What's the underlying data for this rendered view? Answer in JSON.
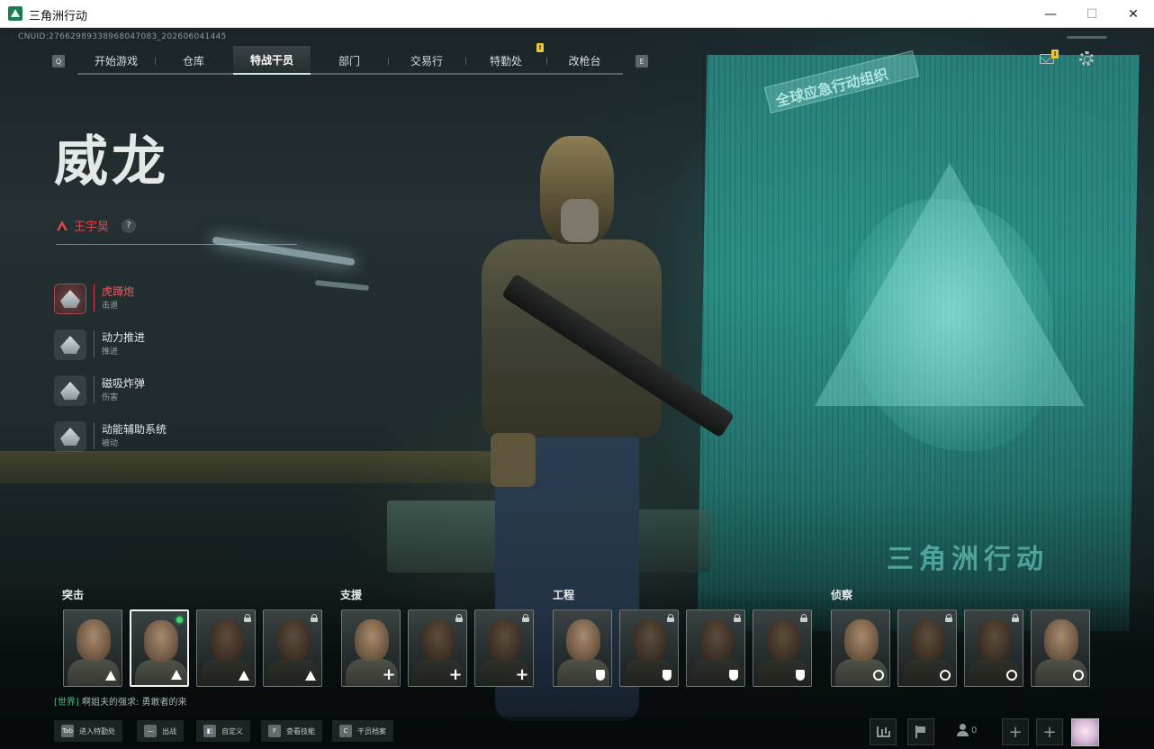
{
  "window": {
    "title": "三角洲行动",
    "minimize": "—",
    "maximize": "☐",
    "close": "✕"
  },
  "hud": {
    "uid": "CNUID:276629893389680470​83_202606041445",
    "nav_left_key": "Q",
    "nav_right_key": "E",
    "tabs": [
      {
        "label": "开始游戏"
      },
      {
        "label": "仓库"
      },
      {
        "label": "特战干员",
        "active": true
      },
      {
        "label": "部门"
      },
      {
        "label": "交易行"
      },
      {
        "label": "特勤处",
        "badge": "!"
      },
      {
        "label": "改枪台"
      }
    ],
    "mail_badge": "!"
  },
  "operator": {
    "name": "威龙",
    "real_name": "王宇昊",
    "help": "?",
    "abilities": [
      {
        "name": "虎蹲炮",
        "type": "击退",
        "selected": true,
        "icon": "cannon-icon"
      },
      {
        "name": "动力推进",
        "type": "推进",
        "icon": "dash-icon"
      },
      {
        "name": "磁吸炸弹",
        "type": "伤害",
        "icon": "bomb-icon"
      },
      {
        "name": "动能辅助系统",
        "type": "被动",
        "icon": "exosuit-icon"
      }
    ]
  },
  "roster": {
    "groups": [
      {
        "label": "突击",
        "class": "assault"
      },
      {
        "label": "支援",
        "class": "support"
      },
      {
        "label": "工程",
        "class": "engineer"
      },
      {
        "label": "侦察",
        "class": "recon"
      }
    ],
    "cards": [
      {
        "group": "assault",
        "locked": false
      },
      {
        "group": "assault",
        "locked": false,
        "selected": true,
        "online": true
      },
      {
        "group": "assault",
        "locked": true
      },
      {
        "group": "assault",
        "locked": true
      },
      {
        "group": "support",
        "locked": false
      },
      {
        "group": "support",
        "locked": true
      },
      {
        "group": "support",
        "locked": true
      },
      {
        "group": "engineer",
        "locked": false
      },
      {
        "group": "engineer",
        "locked": true
      },
      {
        "group": "engineer",
        "locked": true
      },
      {
        "group": "engineer",
        "locked": true
      },
      {
        "group": "recon",
        "locked": false
      },
      {
        "group": "recon",
        "locked": true
      },
      {
        "group": "recon",
        "locked": true
      },
      {
        "group": "recon",
        "locked": false
      }
    ]
  },
  "chat": {
    "channel": "[世界]",
    "text": " 啊姐夫的强求: 勇敢者的来"
  },
  "bottom": {
    "actions": [
      {
        "key": "Tab",
        "label": "进入特勤处"
      },
      {
        "key": "—",
        "label": "出战"
      },
      {
        "key": "◧",
        "label": "自定义"
      },
      {
        "key": "F",
        "label": "查看技能"
      },
      {
        "key": "C",
        "label": "干员档案"
      }
    ],
    "friends_count": "0",
    "add_1": "+",
    "add_2": "+"
  },
  "background": {
    "banner": "全球应急行动组织",
    "logo_text": "三角洲行动"
  },
  "colors": {
    "accent_red": "#e0454b",
    "accent_teal": "#2d9b93",
    "online_green": "#3ddc6a",
    "badge_yellow": "#e8c53a"
  }
}
